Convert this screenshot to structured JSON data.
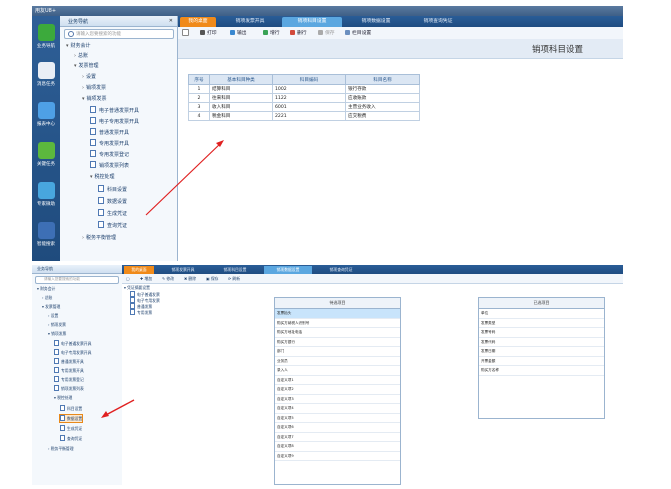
{
  "top": {
    "app_title": "用友U8+",
    "launcher": [
      "业务导航",
      "消息任务",
      "报表中心",
      "关键任务",
      "专家微助",
      "智能搜索"
    ],
    "tree_title": "业务导航",
    "tree_close": "✕",
    "search_placeholder": "请输入您要搜索的功能",
    "tree": [
      "财务会计",
      "总账",
      "发票管理",
      "设置",
      "销项发票",
      "销项发票",
      "电子普通发票开具",
      "电子专用发票开具",
      "普通发票开具",
      "专用发票开具",
      "专用发票登记",
      "销项发票列表",
      "税控处理",
      "科目设置",
      "数据设置",
      "生成凭证",
      "查询凭证",
      "税务平衡管理"
    ],
    "tabs": [
      "我的桌面",
      "销项发票开具",
      "销项科目设置",
      "销项数据设置",
      "销项查询凭证"
    ],
    "toolbar": [
      "打印",
      "输出",
      "增行",
      "删行",
      "保存",
      "栏目设置"
    ],
    "heading": "销项科目设置",
    "table": {
      "headers": [
        "序号",
        "基本科目种类",
        "科目编码",
        "科目名称"
      ],
      "rows": [
        [
          "1",
          "结算科目",
          "1002",
          "银行存款"
        ],
        [
          "2",
          "往来科目",
          "1122",
          "应收账款"
        ],
        [
          "3",
          "收入科目",
          "6001",
          "主营业务收入"
        ],
        [
          "4",
          "税金科目",
          "2221",
          "应交税费"
        ]
      ]
    }
  },
  "bottom": {
    "tree_title": "业务导航",
    "search_placeholder": "请输入您要搜索的功能",
    "tree": [
      "财务会计",
      "总账",
      "发票管理",
      "设置",
      "销项发票",
      "销项发票",
      "电子普通发票开具",
      "电子专用发票开具",
      "普通发票开具",
      "专用发票开具",
      "专用发票登记",
      "销项发票列表",
      "税控处理",
      "科目设置",
      "数据设置",
      "生成凭证",
      "查询凭证",
      "税务平衡管理"
    ],
    "tabs": [
      "我的桌面",
      "销项发票开具",
      "销项科目设置",
      "销项数据设置",
      "销项查询凭证"
    ],
    "toolbar": [
      "增加",
      "修改",
      "删除",
      "保存",
      "刷新"
    ],
    "doc_tree": [
      "凭证摘要设置",
      "电子普通发票",
      "电子专用发票",
      "普通发票",
      "专用发票"
    ],
    "left_list": {
      "header": "待选项目",
      "rows": [
        "发票抬头",
        "购买方纳税人识别号",
        "购买方地址电话",
        "购买方银行",
        "部门",
        "业务员",
        "录入人",
        "自定义项1",
        "自定义项2",
        "自定义项3",
        "自定义项4",
        "自定义项5",
        "自定义项6",
        "自定义项7",
        "自定义项8",
        "自定义项9"
      ]
    },
    "right_list": {
      "header": "已选项目",
      "rows": [
        "单位",
        "发票类型",
        "发票号码",
        "发票代码",
        "发票日期",
        "开票金额",
        "购买方名称"
      ]
    }
  },
  "colors": {
    "arrow": "#e02020",
    "nav_blue": "#1f4b7d",
    "tab_active": "#5ba7e0",
    "tab_orange": "#f08a1a"
  }
}
